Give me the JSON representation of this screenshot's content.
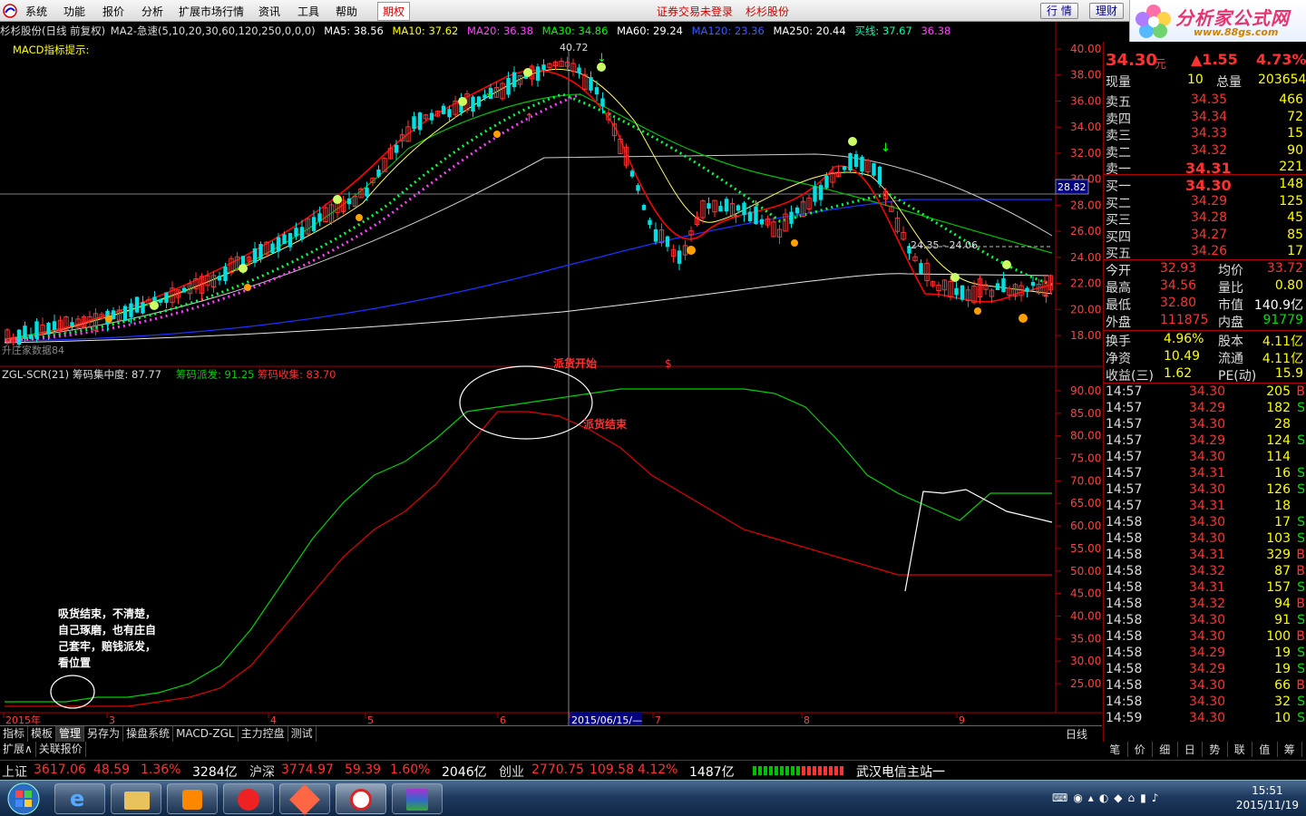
{
  "menu": {
    "items": [
      "系统",
      "功能",
      "报价",
      "分析",
      "扩展市场行情",
      "资讯",
      "工具",
      "帮助"
    ],
    "options_label": "期权",
    "login_status": "证券交易未登录",
    "stock_name": "杉杉股份",
    "quote_button": "行 情",
    "finance_button": "理财",
    "window_controls": [
      "_",
      "□",
      "×"
    ]
  },
  "brand": {
    "title": "分析家公式网",
    "url": "www.88gs.com"
  },
  "chart_header": {
    "title": "杉杉股份(日线 前复权)",
    "ma_formula": "MA2-急速(5,10,20,30,60,120,250,0,0,0)",
    "ma5": "MA5: 38.56",
    "ma10": "MA10: 37.62",
    "ma20": "MA20: 36.38",
    "ma30": "MA30: 34.86",
    "ma60": "MA60: 29.24",
    "ma120": "MA120: 23.36",
    "ma250": "MA250: 20.44",
    "buy_line": "买线: 37.67",
    "buy_line2": "36.38",
    "macd_hint": "MACD指标提示:",
    "high_marker": "40.72",
    "crosshair_price": "28.82",
    "range_label": "24.35 - 24.06",
    "ribbon_label": "升庄家数据84"
  },
  "price_axis": [
    "40.00",
    "38.00",
    "36.00",
    "34.00",
    "32.00",
    "30.00",
    "28.00",
    "26.00",
    "24.00",
    "22.00",
    "20.00",
    "18.00"
  ],
  "indicator": {
    "header_name": "ZGL-SCR(21)",
    "concentration": "筹码集中度: 87.77",
    "distribute": "筹码派发: 91.25",
    "collect": "筹码收集: 83.70",
    "axis": [
      "90.00",
      "85.00",
      "80.00",
      "75.00",
      "70.00",
      "65.00",
      "60.00",
      "55.00",
      "50.00",
      "45.00",
      "40.00",
      "35.00",
      "30.00",
      "25.00"
    ],
    "annotation_start": "派货开始",
    "annotation_end": "派货结束",
    "annotation_dollar": "$",
    "note": [
      "吸货结束，不清楚，",
      "自己琢磨，也有庄自",
      "己套牢，赔钱派发，",
      "看位置"
    ]
  },
  "chart_data": {
    "type": "line",
    "title": "杉杉股份(日线 前复权)",
    "x_labels": [
      "2015年",
      "3",
      "4",
      "5",
      "6",
      "2015/06/15/—",
      "7",
      "8",
      "9"
    ],
    "ylim_price": [
      17,
      41
    ],
    "ylim_indicator": [
      20,
      92
    ],
    "series": [
      {
        "name": "筹码派发",
        "color": "#00d000",
        "values": [
          22,
          22,
          22,
          23,
          23,
          24,
          26,
          30,
          38,
          48,
          58,
          66,
          72,
          75,
          80,
          86,
          87,
          88,
          89,
          90,
          91,
          91,
          91,
          91,
          91,
          90,
          87,
          80,
          72,
          68,
          65,
          62,
          68,
          68,
          68
        ]
      },
      {
        "name": "筹码收集",
        "color": "#e00000",
        "values": [
          21,
          21,
          21,
          21,
          21,
          22,
          23,
          25,
          30,
          38,
          46,
          54,
          60,
          64,
          70,
          78,
          86,
          86,
          85,
          82,
          78,
          72,
          68,
          64,
          60,
          58,
          56,
          54,
          52,
          50,
          50,
          50,
          50,
          50,
          50
        ]
      }
    ]
  },
  "quote": {
    "price": "34.30",
    "price_unit": "元",
    "change": "▲1.55",
    "change_pct": "4.73%",
    "now_vol_label": "现量",
    "now_vol": "10",
    "total_vol_label": "总量",
    "total_vol": "203654",
    "asks": [
      {
        "label": "卖五",
        "price": "34.35",
        "vol": "466"
      },
      {
        "label": "卖四",
        "price": "34.34",
        "vol": "72"
      },
      {
        "label": "卖三",
        "price": "34.33",
        "vol": "15"
      },
      {
        "label": "卖二",
        "price": "34.32",
        "vol": "90"
      },
      {
        "label": "卖一",
        "price": "34.31",
        "vol": "221"
      }
    ],
    "bids": [
      {
        "label": "买一",
        "price": "34.30",
        "vol": "148"
      },
      {
        "label": "买二",
        "price": "34.29",
        "vol": "125"
      },
      {
        "label": "买三",
        "price": "34.28",
        "vol": "45"
      },
      {
        "label": "买四",
        "price": "34.27",
        "vol": "85"
      },
      {
        "label": "买五",
        "price": "34.26",
        "vol": "17"
      }
    ],
    "stats": [
      {
        "l1": "今开",
        "v1": "32.93",
        "l2": "均价",
        "v2": "33.72"
      },
      {
        "l1": "最高",
        "v1": "34.56",
        "l2": "量比",
        "v2": "0.80"
      },
      {
        "l1": "最低",
        "v1": "32.80",
        "l2": "市值",
        "v2": "140.9亿"
      },
      {
        "l1": "外盘",
        "v1": "111875",
        "l2": "内盘",
        "v2": "91779"
      }
    ],
    "stats2": [
      {
        "l1": "换手",
        "v1": "4.96%",
        "l2": "股本",
        "v2": "4.11亿"
      },
      {
        "l1": "净资",
        "v1": "10.49",
        "l2": "流通",
        "v2": "4.11亿"
      },
      {
        "l1": "收益(三)",
        "v1": "1.62",
        "l2": "PE(动)",
        "v2": "15.9"
      }
    ],
    "trades": [
      {
        "t": "14:57",
        "p": "34.30",
        "v": "205",
        "s": "B"
      },
      {
        "t": "14:57",
        "p": "34.29",
        "v": "182",
        "s": "S"
      },
      {
        "t": "14:57",
        "p": "34.30",
        "v": "28",
        "s": ""
      },
      {
        "t": "14:57",
        "p": "34.29",
        "v": "124",
        "s": "S"
      },
      {
        "t": "14:57",
        "p": "34.30",
        "v": "114",
        "s": ""
      },
      {
        "t": "14:57",
        "p": "34.31",
        "v": "16",
        "s": "S"
      },
      {
        "t": "14:57",
        "p": "34.30",
        "v": "126",
        "s": "S"
      },
      {
        "t": "14:57",
        "p": "34.31",
        "v": "18",
        "s": ""
      },
      {
        "t": "14:58",
        "p": "34.30",
        "v": "17",
        "s": "S"
      },
      {
        "t": "14:58",
        "p": "34.30",
        "v": "103",
        "s": "S"
      },
      {
        "t": "14:58",
        "p": "34.31",
        "v": "329",
        "s": "B"
      },
      {
        "t": "14:58",
        "p": "34.32",
        "v": "87",
        "s": "B"
      },
      {
        "t": "14:58",
        "p": "34.31",
        "v": "157",
        "s": "S"
      },
      {
        "t": "14:58",
        "p": "34.32",
        "v": "94",
        "s": "B"
      },
      {
        "t": "14:58",
        "p": "34.30",
        "v": "91",
        "s": "S"
      },
      {
        "t": "14:58",
        "p": "34.30",
        "v": "100",
        "s": "B"
      },
      {
        "t": "14:58",
        "p": "34.29",
        "v": "19",
        "s": "S"
      },
      {
        "t": "14:58",
        "p": "34.29",
        "v": "19",
        "s": "S"
      },
      {
        "t": "14:58",
        "p": "34.30",
        "v": "66",
        "s": "B"
      },
      {
        "t": "14:58",
        "p": "34.30",
        "v": "32",
        "s": "S"
      },
      {
        "t": "14:59",
        "p": "34.30",
        "v": "10",
        "s": "S"
      }
    ]
  },
  "tabs": [
    "指标",
    "模板",
    "管理",
    "另存为",
    "操盘系统",
    "MACD-ZGL",
    "主力控盘",
    "测试"
  ],
  "tabs2": [
    "扩展∧",
    "关联报价"
  ],
  "period_label": "日线",
  "right_tabs": [
    "笔",
    "价",
    "细",
    "日",
    "势",
    "联",
    "值",
    "筹"
  ],
  "index_bar": {
    "sh_label": "上证",
    "sh_val": "3617.06",
    "sh_chg": "48.59",
    "sh_pct": "1.36%",
    "sh_amt": "3284亿",
    "hs_label": "沪深",
    "hs_val": "3774.97",
    "hs_chg": "59.39",
    "hs_pct": "1.60%",
    "hs_amt": "2046亿",
    "cy_label": "创业",
    "cy_val": "2770.75",
    "cy_chg": "109.58",
    "cy_pct": "4.12%",
    "cy_amt": "1487亿",
    "station": "武汉电信主站一"
  },
  "taskbar": {
    "time": "15:51",
    "date": "2015/11/19"
  },
  "colors": {
    "up": "#ff3232",
    "down": "#00e0e0",
    "yellow": "#ffff00",
    "green": "#00d000"
  }
}
